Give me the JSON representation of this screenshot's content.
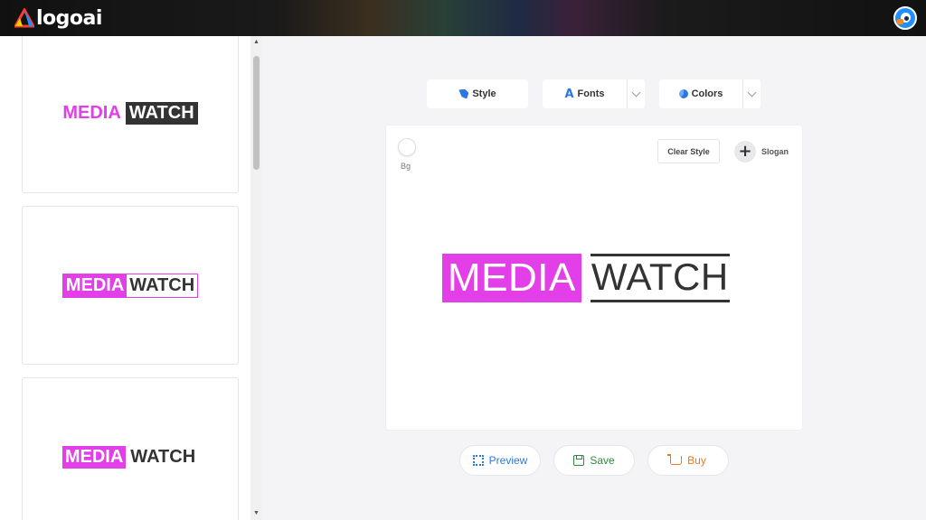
{
  "app": {
    "brand": "logoai"
  },
  "sidebar": {
    "cards": [
      {
        "media": "MEDIA",
        "watch": "WATCH"
      },
      {
        "media": "MEDIA",
        "watch": "WATCH"
      },
      {
        "media": "MEDIA",
        "watch": "WATCH"
      }
    ]
  },
  "toolbar": {
    "style_label": "Style",
    "fonts_label": "Fonts",
    "colors_label": "Colors"
  },
  "canvas": {
    "bg_label": "Bg",
    "clear_style_label": "Clear Style",
    "slogan_label": "Slogan",
    "logo": {
      "media": "MEDIA",
      "watch": "WATCH"
    }
  },
  "actions": {
    "preview_label": "Preview",
    "save_label": "Save",
    "buy_label": "Buy"
  },
  "colors": {
    "accent_magenta": "#e23fe8",
    "dark_text": "#333333",
    "link_blue": "#2b78e4",
    "save_green": "#2e8b3a",
    "buy_orange": "#f07a1a"
  },
  "icons": {
    "style": "magic-icon",
    "fonts": "font-icon",
    "colors": "palette-icon",
    "preview": "expand-icon",
    "save": "save-icon",
    "buy": "cart-icon"
  }
}
